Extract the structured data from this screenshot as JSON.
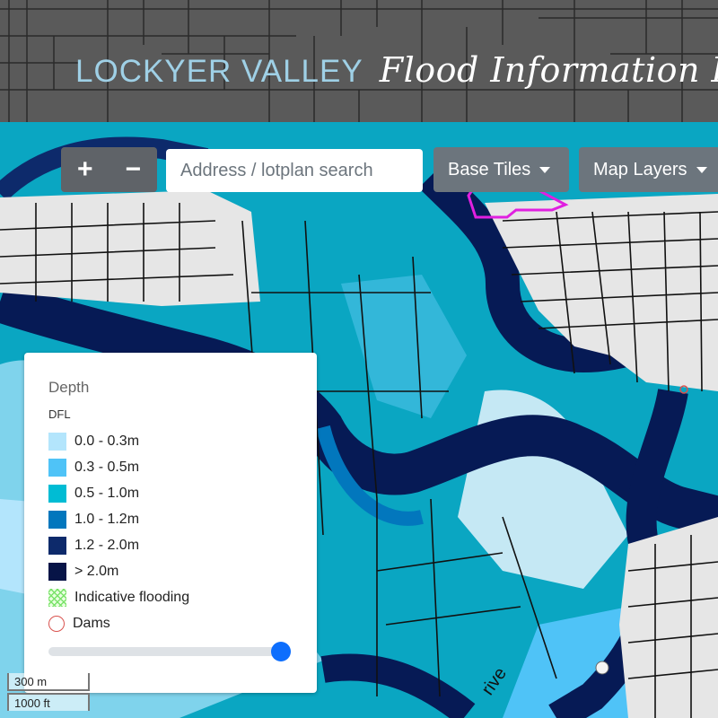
{
  "header": {
    "title_main": "LOCKYER VALLEY",
    "title_script": "Flood Information P"
  },
  "controls": {
    "zoom_in": "+",
    "zoom_out": "−",
    "search_placeholder": "Address / lotplan search",
    "base_tiles_label": "Base Tiles",
    "map_layers_label": "Map Layers"
  },
  "legend": {
    "title": "Depth",
    "subtitle": "DFL",
    "items": [
      {
        "label": "0.0 - 0.3m",
        "color": "#b3e5fc"
      },
      {
        "label": "0.3 - 0.5m",
        "color": "#4fc3f7"
      },
      {
        "label": "0.5 - 1.0m",
        "color": "#00bcd4"
      },
      {
        "label": "1.0 - 1.2m",
        "color": "#0277bd"
      },
      {
        "label": "1.2 - 2.0m",
        "color": "#0d2a6b"
      },
      {
        "label": "> 2.0m",
        "color": "#071447"
      }
    ],
    "indicative_label": "Indicative flooding",
    "dams_label": "Dams",
    "opacity_value": 1.0
  },
  "map": {
    "road_label": "rive"
  },
  "scale": {
    "metric": "300 m",
    "imperial": "1000 ft"
  },
  "colors": {
    "deep": "#061a55",
    "mid": "#0a9fc0",
    "light": "#b8e2f2",
    "land": "#e6e6e6",
    "boundary": "#e020e0"
  }
}
